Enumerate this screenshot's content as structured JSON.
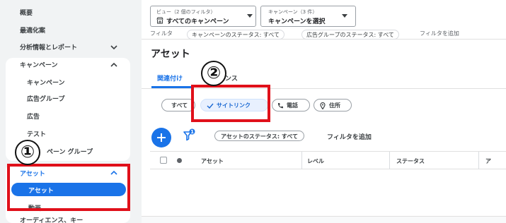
{
  "sidebar": {
    "overview": "概要",
    "recommendations": "最適化案",
    "insights_reports": "分析情報とレポート",
    "campaigns": "キャンペーン",
    "campaigns_children": [
      "キャンペーン",
      "広告グループ",
      "広告",
      "テスト"
    ],
    "campaign_groups_partial": "ペーン グループ",
    "assets_section": "アセット",
    "assets_selected": "アセット",
    "videos": "動画",
    "cut_off_item": "オーディエンス、キー"
  },
  "topbar": {
    "view_dropdown": {
      "small": "ビュー（2 個のフィルタ）",
      "main": "すべてのキャンペーン"
    },
    "campaign_dropdown": {
      "small": "キャンペーン（3 件）",
      "main": "キャンペーンを選択"
    },
    "filter_label": "フィルタ",
    "filter_chips": [
      "キャンペーンのステータス: すべて",
      "広告グループのステータス: すべて"
    ],
    "add_filter": "フィルタを追加"
  },
  "page": {
    "title": "アセット",
    "tabs": [
      "関連付け",
      "パフォーマンス"
    ],
    "tab_2_visible": "ンス"
  },
  "chips": {
    "all": "すべて",
    "sitelinks": "サイトリンク",
    "phone": "電話",
    "address": "住所"
  },
  "toolbar": {
    "filter_badge": "1",
    "status_filter": "アセットのステータス: すべて",
    "add_filter": "フィルタを追加"
  },
  "table": {
    "columns": [
      "アセット",
      "レベル",
      "ステータス",
      "ア"
    ]
  },
  "annotations": {
    "badge_1": "①",
    "badge_2": "②"
  },
  "colors": {
    "accent": "#1a73e8",
    "annotation_red": "#e0101a",
    "sidebar_bg": "#f1f3f4"
  },
  "icons": [
    "chevron-down-icon",
    "chevron-up-icon",
    "store-icon",
    "check-icon",
    "phone-icon",
    "location-pin-icon",
    "add-icon",
    "filter-icon"
  ]
}
